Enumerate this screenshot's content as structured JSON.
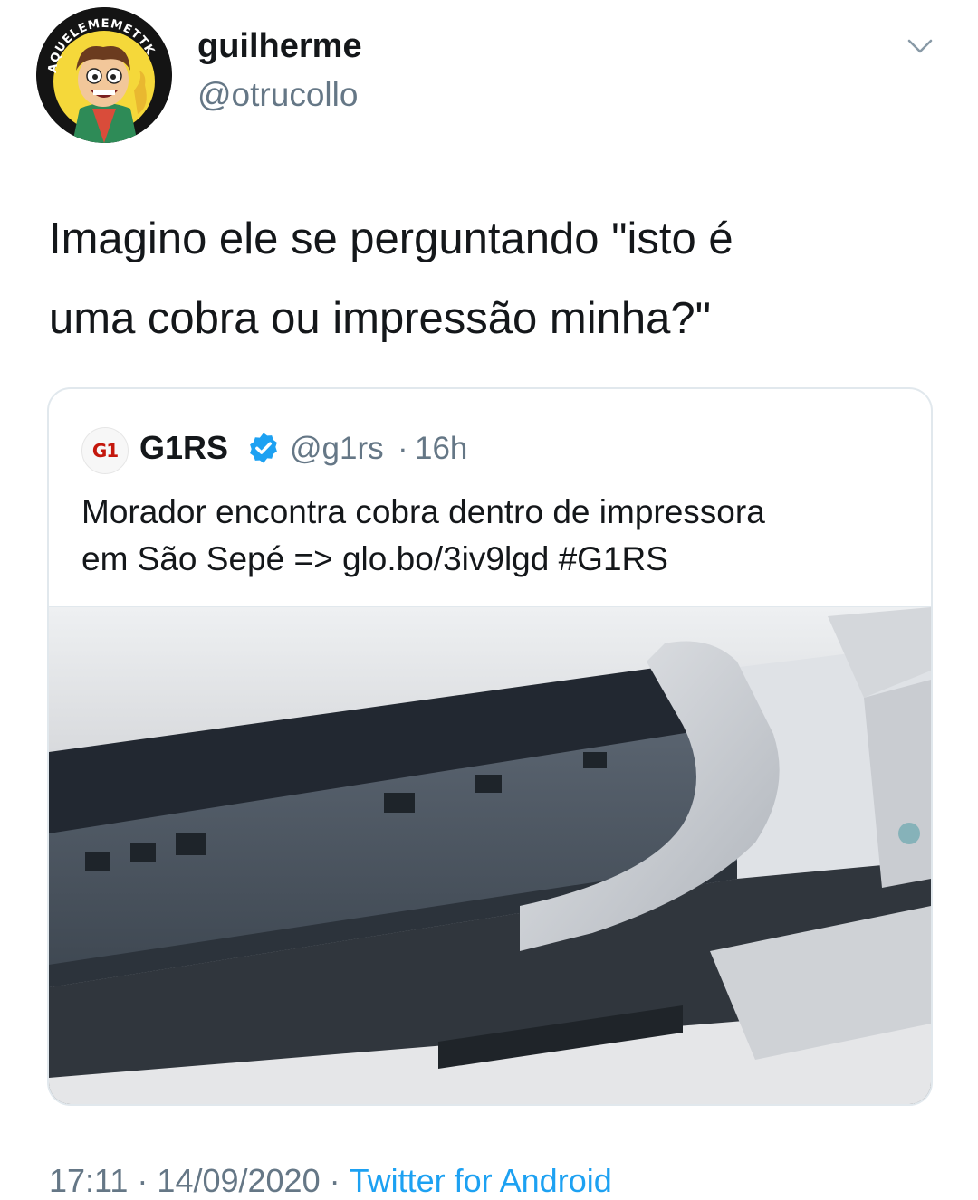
{
  "author": {
    "display_name": "guilherme",
    "handle": "@otrucollo",
    "avatar_badge_text": "AQUELEMEMETTK"
  },
  "tweet": {
    "line1": "Imagino ele se perguntando \"isto é",
    "line2": "uma cobra ou impressão minha?\""
  },
  "quoted_tweet": {
    "avatar_text": "G1",
    "name": "G1RS",
    "verified": true,
    "handle": "@g1rs",
    "separator": "·",
    "time": "16h",
    "line1": "Morador encontra cobra dentro de impressora",
    "line2": "em São Sepé => glo.bo/3iv9lgd #G1RS",
    "media_alt": "printer-interior-photo"
  },
  "footer": {
    "time": "17:11",
    "separator": "·",
    "date": "14/09/2020",
    "source": "Twitter for Android"
  },
  "colors": {
    "text": "#14171a",
    "secondary": "#657786",
    "link": "#1da1f2",
    "border": "#e1e8ed",
    "g1_red": "#c4170c"
  }
}
